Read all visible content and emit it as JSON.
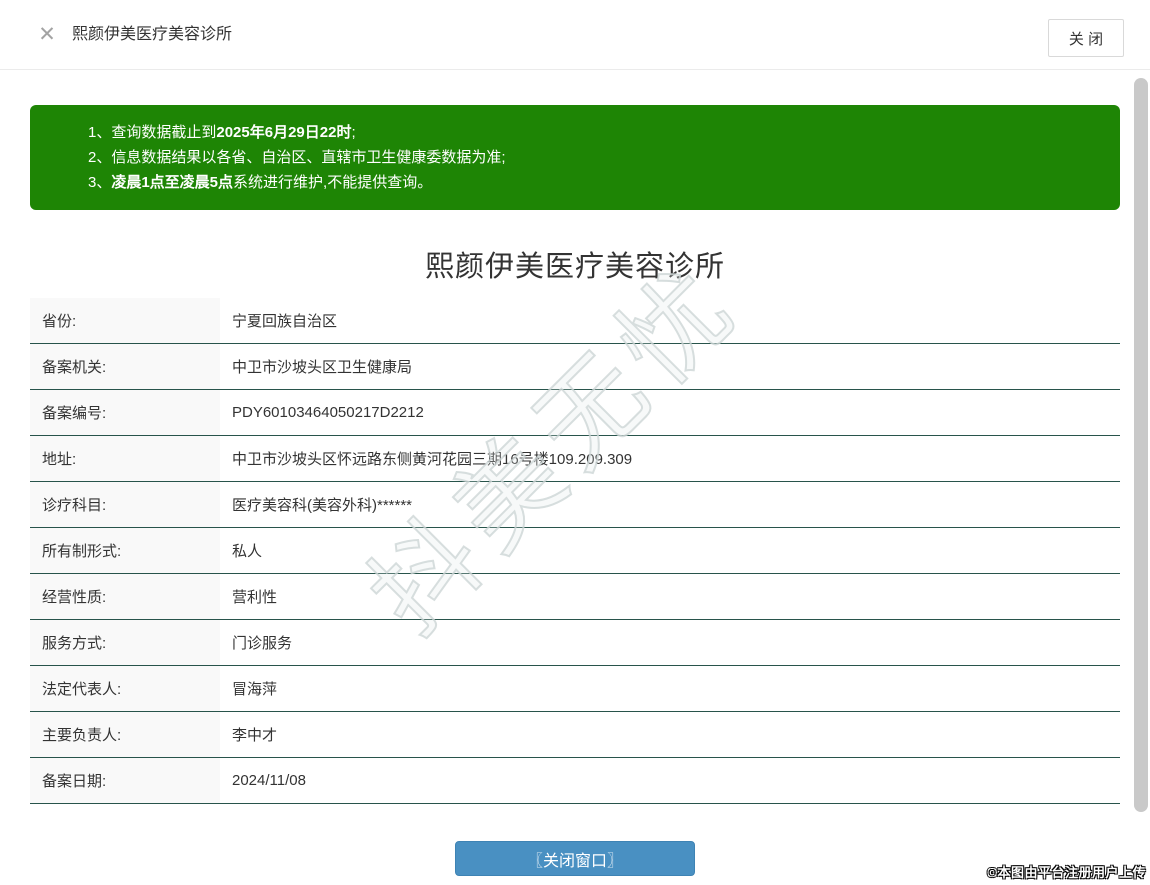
{
  "header": {
    "title": "熙颜伊美医疗美容诊所",
    "close_icon": "✕",
    "close_button": "关 闭"
  },
  "notice": {
    "items": [
      {
        "num": "1、",
        "pre": "查询数据截止到",
        "bold": "2025年6月29日22时",
        "post": ";"
      },
      {
        "num": "2、",
        "pre": "信息数据结果以各省、自治区、直辖市卫生健康委数据为准;",
        "bold": "",
        "post": ""
      },
      {
        "num": "3、",
        "pre": "",
        "bold": "凌晨1点至凌晨5点",
        "post": "系统进行维护,不能提供查询。"
      }
    ]
  },
  "clinic": {
    "title": "熙颜伊美医疗美容诊所",
    "fields": [
      {
        "label": "省份:",
        "value": "宁夏回族自治区"
      },
      {
        "label": "备案机关:",
        "value": "中卫市沙坡头区卫生健康局"
      },
      {
        "label": "备案编号:",
        "value": "PDY60103464050217D2212"
      },
      {
        "label": "地址:",
        "value": "中卫市沙坡头区怀远路东侧黄河花园三期16号楼109.209.309"
      },
      {
        "label": "诊疗科目:",
        "value": "医疗美容科(美容外科)******"
      },
      {
        "label": "所有制形式:",
        "value": "私人"
      },
      {
        "label": "经营性质:",
        "value": "营利性"
      },
      {
        "label": "服务方式:",
        "value": "门诊服务"
      },
      {
        "label": "法定代表人:",
        "value": "冒海萍"
      },
      {
        "label": "主要负责人:",
        "value": "李中才"
      },
      {
        "label": "备案日期:",
        "value": "2024/11/08"
      }
    ]
  },
  "watermark": "抖美无忧",
  "footer": {
    "close_window_button": "〖关闭窗口〗",
    "copyright": "©本图由平台注册用户上传"
  },
  "colors": {
    "notice_green": "#1e8505",
    "button_blue": "#4990c2",
    "table_border": "#28544b"
  }
}
